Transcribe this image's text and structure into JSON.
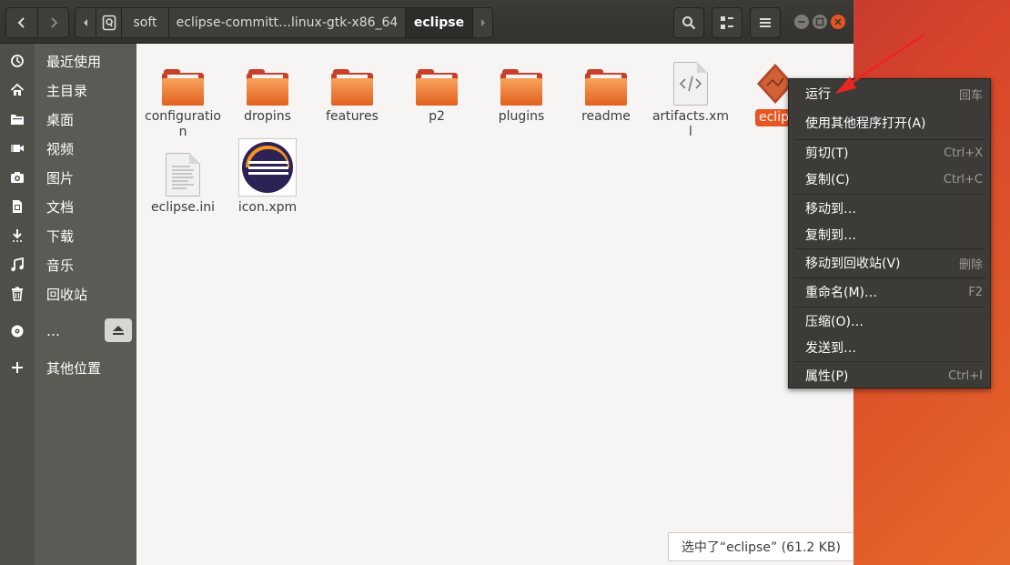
{
  "pathbar": {
    "segments": [
      "soft",
      "eclipse-committ…linux-gtk-x86_64",
      "eclipse"
    ]
  },
  "sidebar": {
    "items": [
      {
        "label": "最近使用",
        "icon": "recent-icon"
      },
      {
        "label": "主目录",
        "icon": "home-icon"
      },
      {
        "label": "桌面",
        "icon": "desktop-icon"
      },
      {
        "label": "视频",
        "icon": "video-icon"
      },
      {
        "label": "图片",
        "icon": "camera-icon"
      },
      {
        "label": "文档",
        "icon": "document-icon"
      },
      {
        "label": "下载",
        "icon": "download-icon"
      },
      {
        "label": "音乐",
        "icon": "music-icon"
      },
      {
        "label": "回收站",
        "icon": "trash-icon"
      },
      {
        "label": "…",
        "icon": "disc-icon"
      },
      {
        "label": "其他位置",
        "icon": "plus-icon"
      }
    ]
  },
  "files": [
    {
      "name": "configuration",
      "type": "folder"
    },
    {
      "name": "dropins",
      "type": "folder"
    },
    {
      "name": "features",
      "type": "folder"
    },
    {
      "name": "p2",
      "type": "folder"
    },
    {
      "name": "plugins",
      "type": "folder"
    },
    {
      "name": "readme",
      "type": "folder"
    },
    {
      "name": "artifacts.xml",
      "type": "xml"
    },
    {
      "name": "eclipse",
      "type": "executable"
    },
    {
      "name": "eclipse.ini",
      "type": "text"
    },
    {
      "name": "icon.xpm",
      "type": "image"
    }
  ],
  "context_menu": {
    "items": [
      {
        "label": "运行",
        "accel": "回车"
      },
      {
        "label": "使用其他程序打开(A)",
        "accel": ""
      },
      {
        "label": "剪切(T)",
        "accel": "Ctrl+X"
      },
      {
        "label": "复制(C)",
        "accel": "Ctrl+C"
      },
      {
        "label": "移动到…",
        "accel": ""
      },
      {
        "label": "复制到…",
        "accel": ""
      },
      {
        "label": "移动到回收站(V)",
        "accel": "删除"
      },
      {
        "label": "重命名(M)…",
        "accel": "F2"
      },
      {
        "label": "压缩(O)…",
        "accel": ""
      },
      {
        "label": "发送到…",
        "accel": ""
      },
      {
        "label": "属性(P)",
        "accel": "Ctrl+I"
      }
    ]
  },
  "status": {
    "text": "选中了“eclipse” (61.2 KB)"
  },
  "colors": {
    "accent": "#e95420",
    "annotation_arrow": "#e8281f"
  }
}
